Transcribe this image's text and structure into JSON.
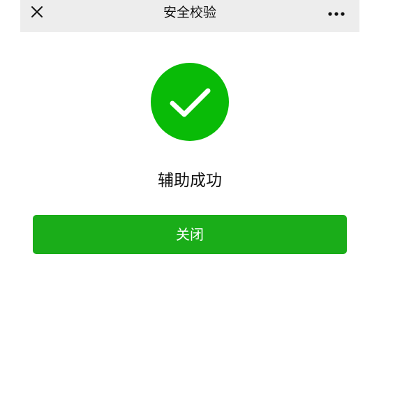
{
  "navbar": {
    "title": "安全校验",
    "close_icon": "close-icon",
    "more_icon": "more-dots-icon"
  },
  "result": {
    "icon": "success-check-icon",
    "message": "辅助成功"
  },
  "actions": {
    "close_label": "关闭"
  },
  "colors": {
    "navbar_bg": "#ededed",
    "success_green": "#09bb07",
    "button_green": "#1aad19"
  }
}
